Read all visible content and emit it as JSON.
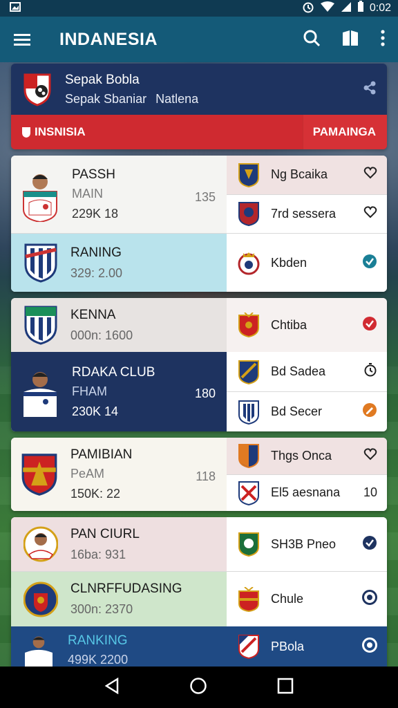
{
  "status_bar": {
    "time": "0:02"
  },
  "app_bar": {
    "title": "INDANESIA"
  },
  "header": {
    "title": "Sepak Bobla",
    "subtitle_left": "Sepak Sbaniar",
    "subtitle_right": "Natlena",
    "bar_left": "INSNISIA",
    "bar_right": "PAMAINGA"
  },
  "groups": [
    {
      "rows": [
        {
          "name": "PASSH",
          "sub": "MAIN",
          "stat": "229K 18",
          "num": "135",
          "right": [
            {
              "label": "Ng Bcaika",
              "end_icon": "heart-outline-icon"
            },
            {
              "label": "7rd sessera",
              "end_icon": "heart-outline-icon"
            }
          ]
        },
        {
          "name": "RANING",
          "sub": "",
          "stat": "329: 2.00",
          "num": "",
          "right": [
            {
              "label": "Kbden",
              "end_icon": "check-circle-icon"
            }
          ]
        }
      ]
    },
    {
      "rows": [
        {
          "name": "KENNA",
          "sub": "",
          "stat": "000n: 1600",
          "num": "",
          "right": [
            {
              "label": "Chtiba",
              "end_icon": "check-circle-icon"
            }
          ]
        },
        {
          "name": "RDAKA CLUB",
          "sub": "FHAM",
          "stat": "230K 14",
          "num": "180",
          "right": [
            {
              "label": "Bd Sadea",
              "end_icon": "timer-icon"
            },
            {
              "label": "Bd Secer",
              "end_icon": "edit-circle-icon"
            }
          ]
        }
      ]
    },
    {
      "rows": [
        {
          "name": "PAMIBIAN",
          "sub": "PeAM",
          "stat": "150K: 22",
          "num": "118",
          "right": [
            {
              "label": "Thgs Onca",
              "end_icon": "heart-outline-icon"
            },
            {
              "label": "El5 aesnana",
              "end_text": "10"
            }
          ]
        }
      ]
    },
    {
      "rows": [
        {
          "name": "PAN CIURL",
          "sub": "",
          "stat": "16ba: 931",
          "num": "",
          "right": [
            {
              "label": "SH3B Pneo",
              "end_icon": "check-circle-icon"
            }
          ]
        },
        {
          "name": "CLNRFFUDASING",
          "sub": "",
          "stat": "300n: 2370",
          "num": "",
          "right": [
            {
              "label": "Chule",
              "end_icon": "radio-target-icon"
            }
          ]
        },
        {
          "name": "RANKING",
          "sub": "",
          "stat": "499K 2200",
          "num": "",
          "right": [
            {
              "label": "PBola",
              "end_icon": "radio-target-icon"
            }
          ]
        }
      ]
    }
  ],
  "colors": {
    "app_bar": "#145a78",
    "header_dark": "#1e3360",
    "header_red": "#cf2a30",
    "check_teal": "#1a7f96",
    "check_red": "#d12b32",
    "check_navy": "#1e3360",
    "check_orange": "#e07a22"
  }
}
